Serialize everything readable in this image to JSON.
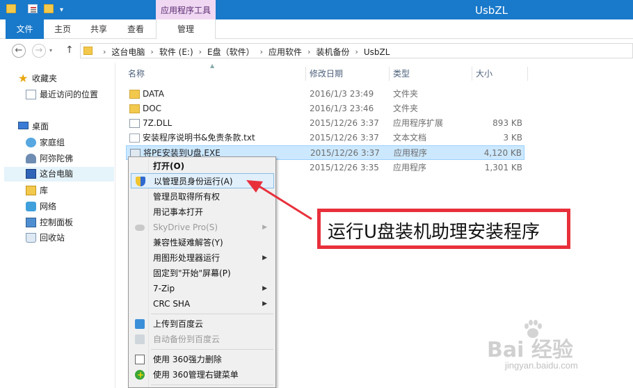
{
  "window": {
    "title": "UsbZL",
    "contextual_tab": "应用程序工具",
    "quick_access_arrow": "▾"
  },
  "ribbon": {
    "tabs": [
      "文件",
      "主页",
      "共享",
      "查看",
      "管理"
    ]
  },
  "navigation": {
    "back": "←",
    "forward": "→",
    "up": "↑",
    "breadcrumb": [
      "这台电脑",
      "软件 (E:)",
      "E盘（软件）",
      "应用软件",
      "装机备份",
      "UsbZL"
    ]
  },
  "nav_pane": {
    "items": [
      {
        "label": "收藏夹",
        "icon": "star-icon"
      },
      {
        "label": "最近访问的位置",
        "icon": "recent-places-icon"
      },
      {
        "label": "桌面",
        "icon": "desktop-icon"
      },
      {
        "label": "家庭组",
        "icon": "homegroup-icon"
      },
      {
        "label": "阿弥陀佛",
        "icon": "user-icon"
      },
      {
        "label": "这台电脑",
        "icon": "this-pc-icon"
      },
      {
        "label": "库",
        "icon": "library-icon"
      },
      {
        "label": "网络",
        "icon": "network-icon"
      },
      {
        "label": "控制面板",
        "icon": "control-panel-icon"
      },
      {
        "label": "回收站",
        "icon": "recycle-bin-icon"
      }
    ],
    "selected": "这台电脑"
  },
  "file_list": {
    "columns": {
      "name": "名称",
      "date": "修改日期",
      "type": "类型",
      "size": "大小"
    },
    "rows": [
      {
        "name": "DATA",
        "date": "2016/1/3 23:49",
        "type": "文件夹",
        "size": "",
        "icon": "folder-icon"
      },
      {
        "name": "DOC",
        "date": "2016/1/3 23:46",
        "type": "文件夹",
        "size": "",
        "icon": "folder-icon"
      },
      {
        "name": "7Z.DLL",
        "date": "2015/12/26 3:37",
        "type": "应用程序扩展",
        "size": "893 KB",
        "icon": "dll-file-icon"
      },
      {
        "name": "安装程序说明书&免责条款.txt",
        "date": "2015/12/26 3:37",
        "type": "文本文档",
        "size": "3 KB",
        "icon": "text-file-icon"
      },
      {
        "name": "将PE安装到U盘.EXE",
        "date": "2015/12/26 3:37",
        "type": "应用程序",
        "size": "4,120 KB",
        "icon": "exe-file-icon"
      },
      {
        "name": "",
        "date": "2015/12/26 3:35",
        "type": "应用程序",
        "size": "1,301 KB",
        "icon": "exe-file-icon"
      }
    ],
    "selected_row": "将PE安装到U盘.EXE"
  },
  "context_menu": {
    "items": [
      {
        "label": "打开(O)",
        "bold": true
      },
      {
        "label": "以管理员身份运行(A)",
        "icon": "uac-shield-icon",
        "highlighted": true
      },
      {
        "label": "管理员取得所有权"
      },
      {
        "label": "用记事本打开"
      },
      {
        "label": "SkyDrive Pro(S)",
        "icon": "skydrive-cloud-icon",
        "disabled": true,
        "submenu": true
      },
      {
        "label": "兼容性疑难解答(Y)"
      },
      {
        "label": "用图形处理器运行",
        "submenu": true
      },
      {
        "label": "固定到\"开始\"屏幕(P)"
      },
      {
        "label": "7-Zip",
        "submenu": true
      },
      {
        "label": "CRC SHA",
        "submenu": true
      },
      {
        "label": "上传到百度云",
        "icon": "baidu-upload-icon"
      },
      {
        "label": "自动备份到百度云",
        "icon": "baidu-autobackup-icon",
        "disabled": true
      },
      {
        "label": "使用 360强力删除",
        "icon": "shred-icon"
      },
      {
        "label": "使用 360管理右键菜单",
        "icon": "360-icon"
      }
    ],
    "submenu_arrow": "▶"
  },
  "callout": {
    "text": "运行U盘装机助理安装程序",
    "border_color": "#e8303b"
  },
  "watermark": {
    "logo": "Bai  经验",
    "url": "jingyan.baidu.com"
  },
  "colors": {
    "titlebar": "#1979ca",
    "contextual_tab": "#f0d8f3",
    "selection": "#cce8ff"
  }
}
